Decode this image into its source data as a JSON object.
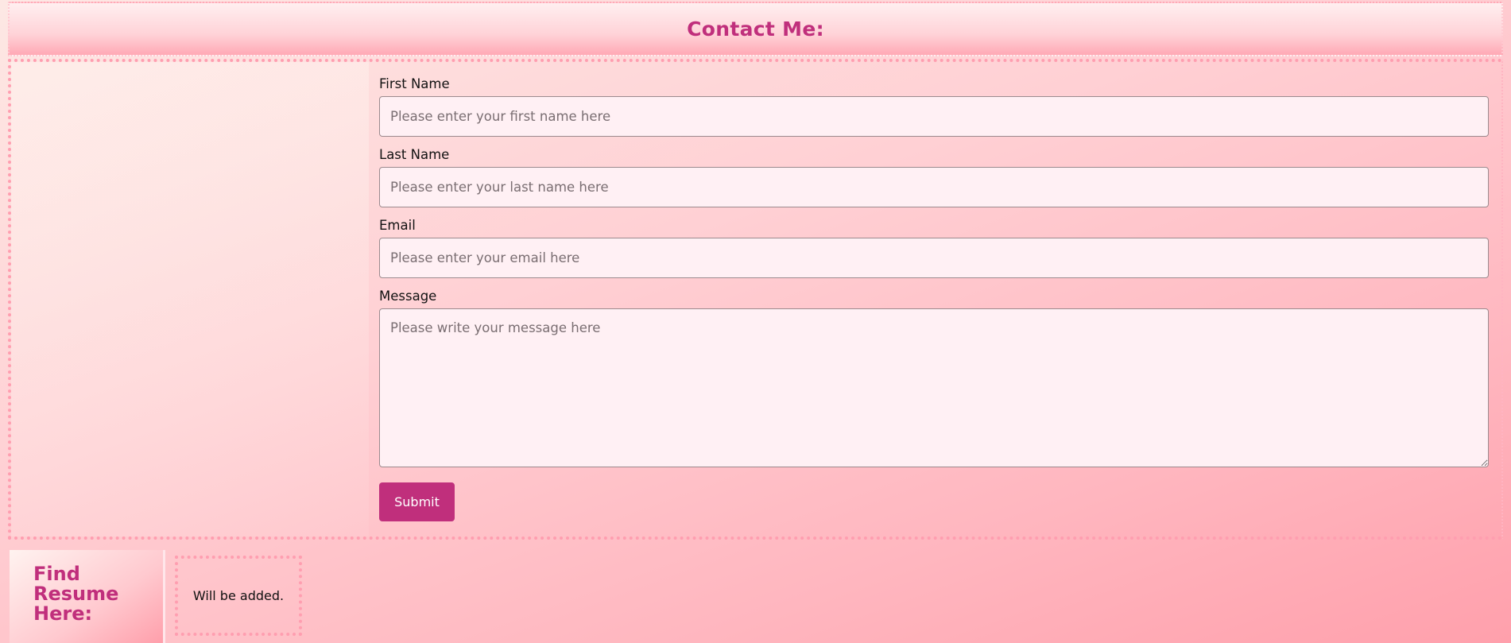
{
  "header": {
    "title": "Contact Me:"
  },
  "form": {
    "fields": [
      {
        "label": "First Name",
        "placeholder": "Please enter your first name here"
      },
      {
        "label": "Last Name",
        "placeholder": "Please enter your last name here"
      },
      {
        "label": "Email",
        "placeholder": "Please enter your email here"
      },
      {
        "label": "Message",
        "placeholder": "Please write your message here"
      }
    ],
    "submit_label": "Submit"
  },
  "resume": {
    "title": "Find Resume Here:",
    "text": "Will be added."
  },
  "colors": {
    "accent": "#c02f7c",
    "border": "#ff9eb0",
    "input_bg": "#fff0f4"
  }
}
